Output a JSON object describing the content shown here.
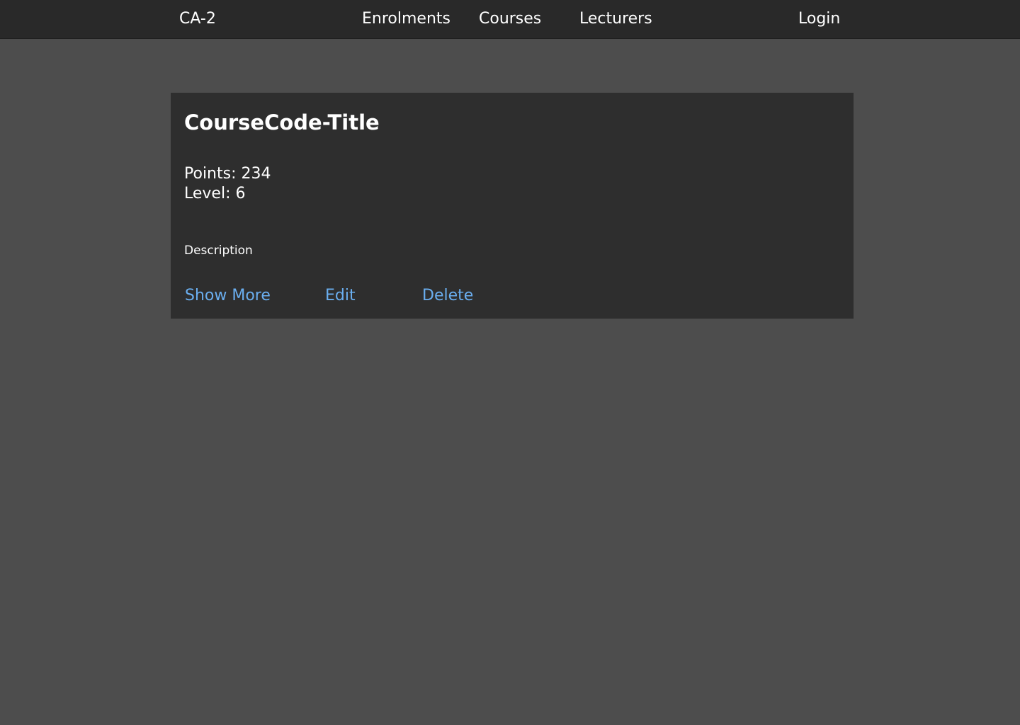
{
  "navbar": {
    "brand": "CA-2",
    "links": [
      "Enrolments",
      "Courses",
      "Lecturers"
    ],
    "login": "Login"
  },
  "course_card": {
    "title": "CourseCode-Title",
    "points": "Points: 234",
    "level": "Level: 6",
    "description": "Description",
    "actions": {
      "show_more": "Show More",
      "edit": "Edit",
      "delete": "Delete"
    }
  },
  "colors": {
    "page_background": "#4d4d4d",
    "navbar_background": "#292929",
    "card_background": "#2e2e2e",
    "link_accent": "#6aaeef",
    "text": "#ffffff"
  }
}
